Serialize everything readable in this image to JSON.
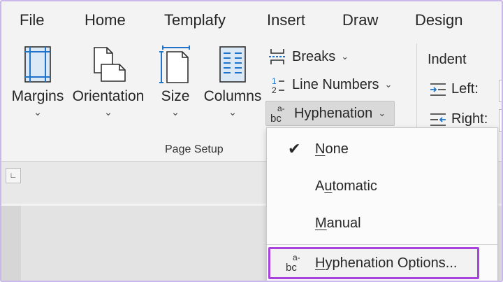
{
  "tabs": [
    "File",
    "Home",
    "Templafy",
    "Insert",
    "Draw",
    "Design"
  ],
  "ribbon": {
    "margins": "Margins",
    "orientation": "Orientation",
    "size": "Size",
    "columns": "Columns",
    "breaks": "Breaks",
    "line_numbers": "Line Numbers",
    "hyphenation": "Hyphenation",
    "group_label": "Page Setup",
    "indent_title": "Indent",
    "indent_left": "Left:",
    "indent_right": "Right:"
  },
  "hyphenation_menu": {
    "none": {
      "first": "N",
      "rest": "one",
      "checked": true
    },
    "automatic": {
      "pre": "A",
      "ul": "u",
      "rest": "tomatic"
    },
    "manual": {
      "first": "M",
      "rest": "anual"
    },
    "options": {
      "first": "H",
      "rest": "yphenation Options..."
    }
  },
  "icons": {
    "checkmark": "check-icon",
    "hyphenation": "hyphenation-icon"
  },
  "colors": {
    "highlight_border": "#a743dc",
    "window_border": "#c9b8e8"
  }
}
